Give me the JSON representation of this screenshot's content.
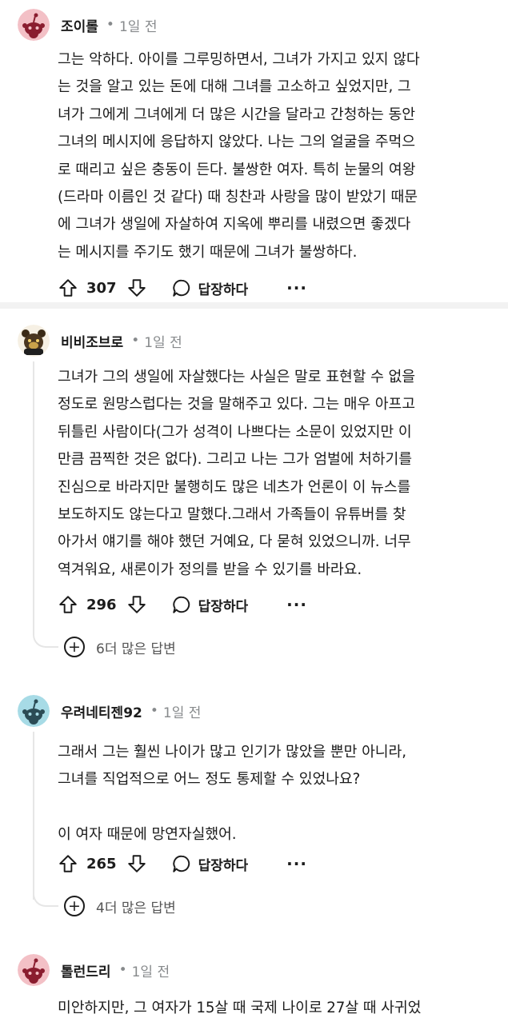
{
  "comments": [
    {
      "username": "조이롤",
      "time_dot": "•",
      "time": "1일 전",
      "avatar_color": "#f3c0c6",
      "body": "그는 악하다. 아이를 그루밍하면서, 그녀가 가지고 있지 않다\n는 것을 알고 있는 돈에 대해 그녀를 고소하고 싶었지만, 그\n녀가 그에게 그녀에게 더 많은 시간을 달라고 간청하는 동안\n그녀의 메시지에 응답하지 않았다. 나는 그의 얼굴을 주먹으\n로 때리고 싶은 충동이 든다. 불쌍한 여자. 특히 눈물의 여왕\n(드라마 이름인 것 같다) 때 칭찬과 사랑을 많이 받았기 때문\n에 그녀가 생일에 자살하여 지옥에 뿌리를 내렸으면 좋겠다\n는 메시지를 주기도 했기 때문에 그녀가 불쌍하다.",
      "score": "307",
      "reply_label": "답장하다",
      "more_label": "···"
    },
    {
      "username": "비비조브로",
      "time_dot": "•",
      "time": "1일 전",
      "body": "그녀가 그의 생일에 자살했다는 사실은 말로 표현할 수 없을\n정도로 원망스럽다는 것을 말해주고 있다. 그는 매우 아프고\n뒤틀린 사람이다(그가 성격이 나쁘다는 소문이 있었지만 이\n만큼 끔찍한 것은 없다). 그리고 나는 그가 엄벌에 처하기를\n진심으로 바라지만 불행히도 많은 네츠가 언론이 이 뉴스를\n보도하지도 않는다고 말했다.그래서 가족들이 유튜버를 찾\n아가서 얘기를 해야 했던 거예요, 다 묻혀 있었으니까. 너무\n역겨워요, 새론이가 정의를 받을 수 있기를 바라요.",
      "score": "296",
      "reply_label": "답장하다",
      "more_label": "···",
      "more_replies": "6더 많은 답변"
    },
    {
      "username": "우려네티젠92",
      "time_dot": "•",
      "time": "1일 전",
      "avatar_color": "#a7dbe6",
      "body": "그래서 그는 훨씬 나이가 많고 인기가 많았을 뿐만 아니라,\n그녀를 직업적으로 어느 정도 통제할 수 있었나요?\n\n이 여자 때문에 망연자실했어.",
      "score": "265",
      "reply_label": "답장하다",
      "more_label": "···",
      "more_replies": "4더 많은 답변"
    },
    {
      "username": "톨런드리",
      "time_dot": "•",
      "time": "1일 전",
      "avatar_color": "#f3c0c6",
      "body": "미안하지만, 그 여자가 15살 때 국제 나이로 27살 때 사귀었"
    }
  ],
  "icons": {
    "upvote": "upvote-arrow-icon",
    "downvote": "downvote-arrow-icon",
    "reply": "speech-bubble-icon",
    "more_replies": "plus-circle-icon"
  }
}
